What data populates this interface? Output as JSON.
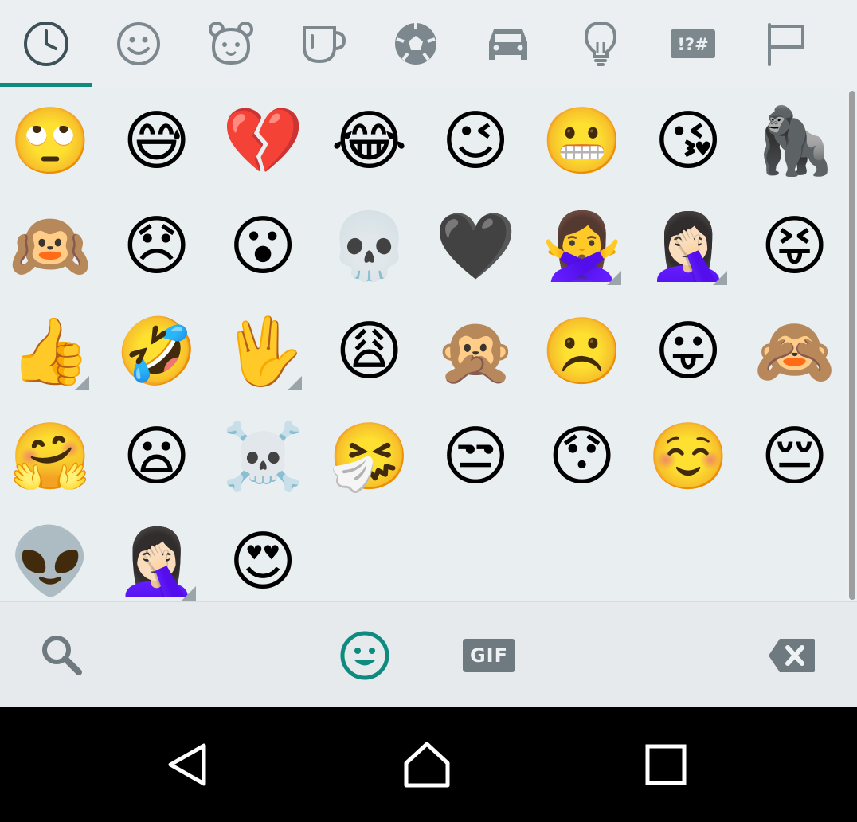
{
  "colors": {
    "accent": "#0f8a7e",
    "icon_gray": "#6f7a80",
    "tab_bg": "#eceff1",
    "grid_bg": "#e9eef1"
  },
  "tabs": [
    {
      "name": "recent",
      "icon": "clock-icon",
      "selected": true
    },
    {
      "name": "smileys",
      "icon": "smiley-icon",
      "selected": false
    },
    {
      "name": "animals",
      "icon": "bear-icon",
      "selected": false
    },
    {
      "name": "food",
      "icon": "cup-icon",
      "selected": false
    },
    {
      "name": "activity",
      "icon": "soccer-ball-icon",
      "selected": false
    },
    {
      "name": "travel",
      "icon": "car-icon",
      "selected": false
    },
    {
      "name": "objects",
      "icon": "lightbulb-icon",
      "selected": false
    },
    {
      "name": "symbols",
      "icon": "symbols-icon",
      "label": "!?#",
      "selected": false
    },
    {
      "name": "flags",
      "icon": "flag-icon",
      "selected": false
    }
  ],
  "emojis": [
    "🙄",
    "😅",
    "💔",
    "😂",
    "😉",
    "😬",
    "😘",
    "🦍",
    "🙉",
    "😞",
    "😮",
    "💀",
    "🖤",
    "🙅‍♀️",
    "🤦🏻‍♀️",
    "😝",
    "👍",
    "🤣",
    "🖖",
    "😩",
    "🙊",
    "☹️",
    "😛",
    "🙈",
    "🤗",
    "😦",
    "☠️",
    "🤧",
    "😒",
    "😯",
    "☺️",
    "😔",
    "👽",
    "🤦🏻‍♀️",
    "😍"
  ],
  "variant_indicator_cells": [
    13,
    14,
    16,
    18,
    33
  ],
  "bottom_bar": {
    "search": "search-icon",
    "emoji": "smiley-icon",
    "gif_label": "GIF",
    "backspace": "backspace-icon"
  },
  "nav_bar": {
    "back": "back-triangle-icon",
    "home": "home-icon",
    "recents": "recents-square-icon"
  }
}
